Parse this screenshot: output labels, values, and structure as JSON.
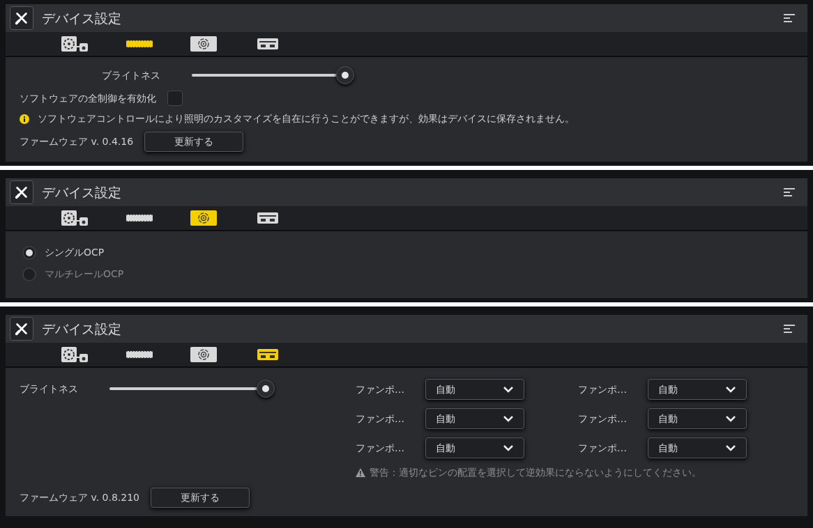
{
  "panels": [
    {
      "title": "デバイス設定",
      "tabs": [
        {
          "kind": "cooler",
          "selected": false
        },
        {
          "kind": "memory",
          "selected": true
        },
        {
          "kind": "psu",
          "selected": false
        },
        {
          "kind": "hub",
          "selected": false
        }
      ],
      "brightness": {
        "label": "ブライトネス",
        "level": 0.98
      },
      "software_control": {
        "label": "ソフトウェアの全制御を有効化",
        "checked": false
      },
      "note": "ソフトウェアコントロールにより照明のカスタマイズを自在に行うことができますが、効果はデバイスに保存されません。",
      "firmware": {
        "label": "ファームウェア v. 0.4.16",
        "button": "更新する"
      }
    },
    {
      "title": "デバイス設定",
      "tabs": [
        {
          "kind": "cooler",
          "selected": false
        },
        {
          "kind": "memory",
          "selected": false
        },
        {
          "kind": "psu",
          "selected": true
        },
        {
          "kind": "hub",
          "selected": false
        }
      ],
      "ocp_options": [
        {
          "label": "シングルOCP",
          "selected": true
        },
        {
          "label": "マルチレールOCP",
          "selected": false
        }
      ]
    },
    {
      "title": "デバイス設定",
      "tabs": [
        {
          "kind": "cooler",
          "selected": false
        },
        {
          "kind": "memory",
          "selected": false
        },
        {
          "kind": "psu",
          "selected": false
        },
        {
          "kind": "hub",
          "selected": true
        }
      ],
      "brightness": {
        "label": "ブライトネス",
        "level": 1.0
      },
      "fan_ports": [
        {
          "label": "ファンポ…",
          "value": "自動"
        },
        {
          "label": "ファンポ…",
          "value": "自動"
        },
        {
          "label": "ファンポ…",
          "value": "自動"
        },
        {
          "label": "ファンポ…",
          "value": "自動"
        },
        {
          "label": "ファンポ…",
          "value": "自動"
        },
        {
          "label": "ファンポ…",
          "value": "自動"
        }
      ],
      "warning": "警告：適切なピンの配置を選択して逆効果にならないようにしてください。",
      "firmware": {
        "label": "ファームウェア v. 0.8.210",
        "button": "更新する"
      }
    }
  ]
}
